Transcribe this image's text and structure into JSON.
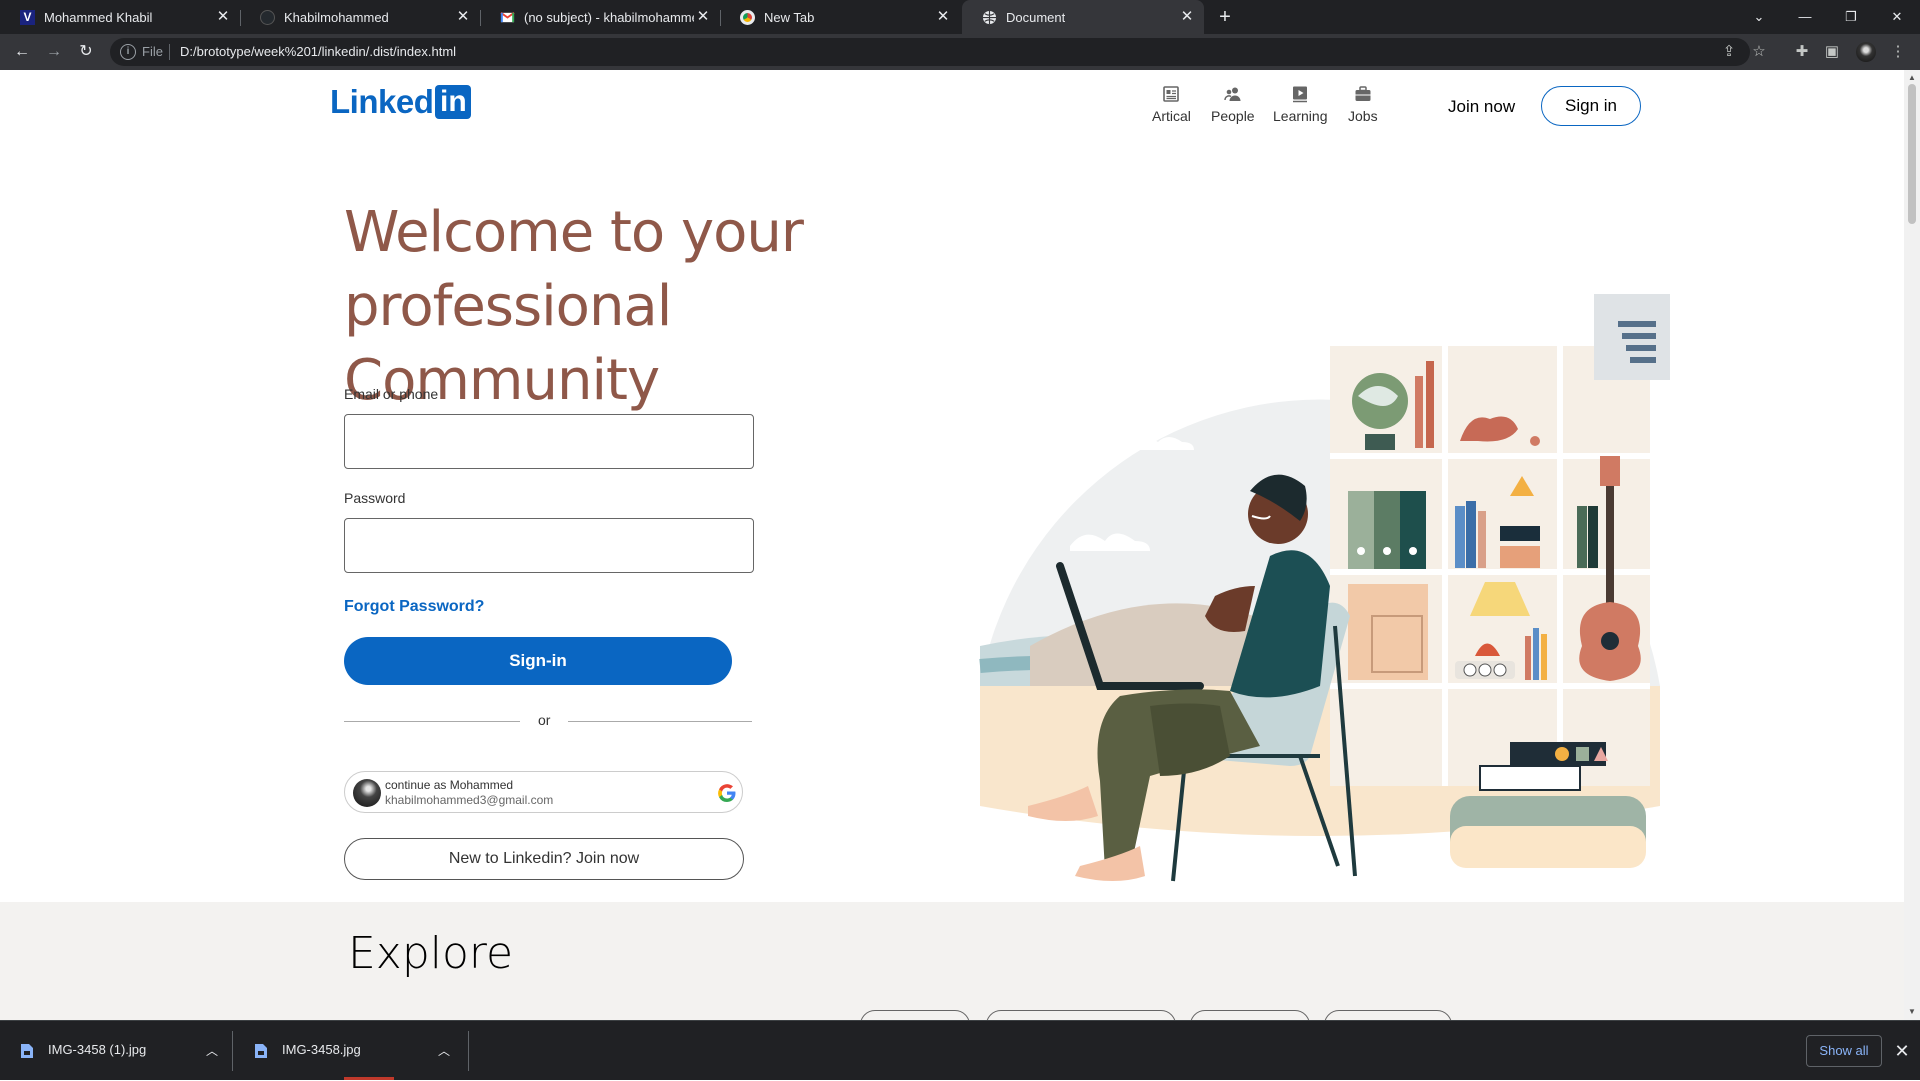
{
  "browser": {
    "tabs": [
      {
        "title": "Mohammed Khabil",
        "icon": "v-logo-icon",
        "active": false
      },
      {
        "title": "Khabilmohammed",
        "icon": "github-icon",
        "active": false
      },
      {
        "title": "(no subject) - khabilmohammed3",
        "icon": "gmail-icon",
        "active": false
      },
      {
        "title": "New Tab",
        "icon": "chrome-icon",
        "active": false
      },
      {
        "title": "Document",
        "icon": "globe-icon",
        "active": true
      }
    ],
    "address": {
      "scheme_label": "File",
      "url": "D:/brototype/week%201/linkedin/.dist/index.html"
    }
  },
  "header": {
    "logo_text": "Linked",
    "logo_box": "in",
    "nav": [
      {
        "label": "Artical",
        "icon": "article-icon"
      },
      {
        "label": "People",
        "icon": "people-icon"
      },
      {
        "label": "Learning",
        "icon": "learning-icon"
      },
      {
        "label": "Jobs",
        "icon": "briefcase-icon"
      }
    ],
    "join_now": "Join now",
    "sign_in": "Sign in"
  },
  "hero": {
    "title_line1": "Welcome to your",
    "title_line2": "professional Community"
  },
  "form": {
    "email_label": "Email or phone",
    "email_value": "",
    "password_label": "Password",
    "password_value": "",
    "forgot": "Forgot Password?",
    "submit": "Sign-in",
    "or": "or",
    "google": {
      "line1": "continue as Mohammed",
      "line2": "khabilmohammed3@gmail.com"
    },
    "join": "New to Linkedin? Join now"
  },
  "explore": {
    "title": "Explore"
  },
  "downloads": {
    "items": [
      {
        "name": "IMG-3458 (1).jpg"
      },
      {
        "name": "IMG-3458.jpg"
      }
    ],
    "show_all": "Show all"
  },
  "colors": {
    "brand": "#0a66c2",
    "hero_title": "#8f5849",
    "chrome_dark": "#202124",
    "chrome_toolbar": "#35363a"
  }
}
